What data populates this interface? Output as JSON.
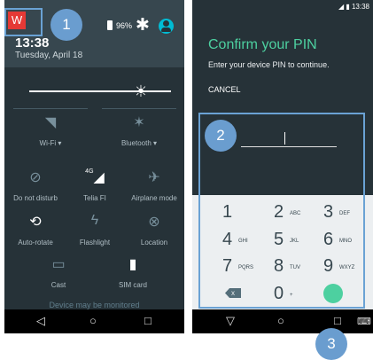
{
  "left_screen": {
    "app_badge": "W",
    "time": "13:38",
    "date": "Tuesday, April 18",
    "battery_pct": "96%",
    "icons": {
      "settings": "gear-icon",
      "user": "user-account-icon"
    },
    "tiles": [
      {
        "label": "Wi-Fi ▾",
        "icon": "wifi-off-icon"
      },
      {
        "label": "Bluetooth ▾",
        "icon": "bluetooth-off-icon"
      },
      {
        "label": "Do not disturb",
        "icon": "do-not-disturb-icon"
      },
      {
        "label": "Telia FI",
        "icon": "cell-signal-icon",
        "badge": "4G"
      },
      {
        "label": "Airplane mode",
        "icon": "airplane-icon"
      },
      {
        "label": "Auto-rotate",
        "icon": "auto-rotate-icon"
      },
      {
        "label": "Flashlight",
        "icon": "flashlight-icon"
      },
      {
        "label": "Location",
        "icon": "location-icon"
      },
      {
        "label": "Cast",
        "icon": "cast-icon"
      },
      {
        "label": "SIM card",
        "icon": "sim-card-icon"
      }
    ],
    "footer_note": "Device may be monitored"
  },
  "right_screen": {
    "status_time": "13:38",
    "title": "Confirm your PIN",
    "subtitle": "Enter your device PIN to continue.",
    "cancel_label": "CANCEL",
    "keypad": [
      {
        "num": "1",
        "sub": ""
      },
      {
        "num": "2",
        "sub": "ABC"
      },
      {
        "num": "3",
        "sub": "DEF"
      },
      {
        "num": "4",
        "sub": "GHI"
      },
      {
        "num": "5",
        "sub": "JKL"
      },
      {
        "num": "6",
        "sub": "MNO"
      },
      {
        "num": "7",
        "sub": "PQRS"
      },
      {
        "num": "8",
        "sub": "TUV"
      },
      {
        "num": "9",
        "sub": "WXYZ"
      },
      {
        "num": "0",
        "sub": "+"
      }
    ],
    "backspace_glyph": "x"
  },
  "nav": {
    "back": "◁",
    "home": "○",
    "recents": "□"
  },
  "callouts": {
    "one": "1",
    "two": "2",
    "three": "3"
  },
  "colors": {
    "accent": "#4dd0a0",
    "callout": "#6a9dcf",
    "panel": "#263238"
  }
}
